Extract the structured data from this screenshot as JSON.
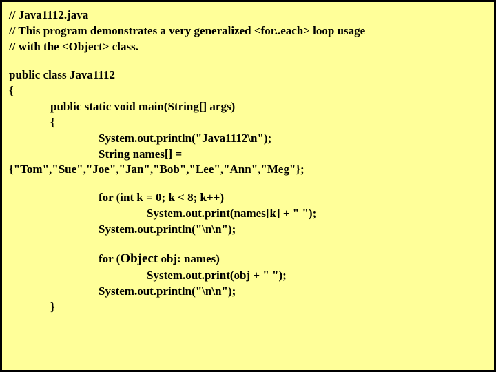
{
  "code": {
    "l1": "// Java1112.java",
    "l2": "// This program demonstrates a very generalized <for..each> loop usage",
    "l3": "// with the <Object> class.",
    "l4": "public class Java1112",
    "l5": "{",
    "l6": "public static void main(String[] args)",
    "l7": "{",
    "l8": "System.out.println(\"Java1112\\n\");",
    "l9": "String names[] =",
    "l10": "{\"Tom\",\"Sue\",\"Joe\",\"Jan\",\"Bob\",\"Lee\",\"Ann\",\"Meg\"};",
    "l11": "for (int k = 0; k < 8; k++)",
    "l12": "System.out.print(names[k] + \" \");",
    "l13": "System.out.println(\"\\n\\n\");",
    "l14a": "for (",
    "l14b": "Object",
    "l14c": " obj: names)",
    "l15": "System.out.print(obj + \" \");",
    "l16": "System.out.println(\"\\n\\n\");",
    "l17": "}"
  }
}
